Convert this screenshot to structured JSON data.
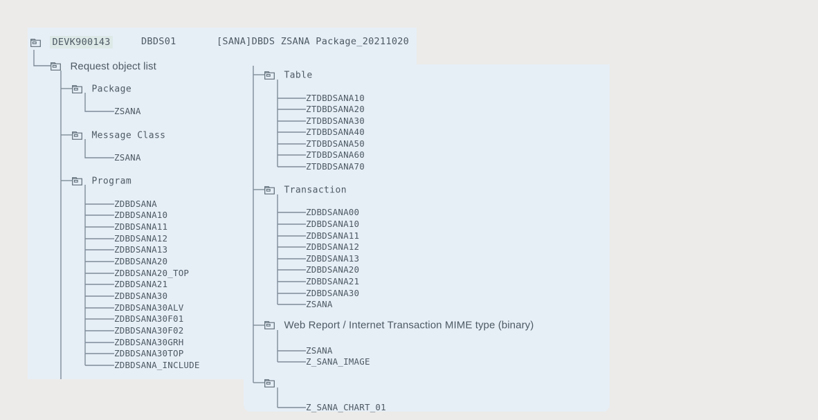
{
  "header": {
    "folder_icon": "folder-icon",
    "request_id": "DEVK900143",
    "system": "DBDS01",
    "description": "[SANA]DBDS ZSANA Package_20211020"
  },
  "colors": {
    "page_background": "#ecebe9",
    "panel_background": "#e6eef6",
    "tree_line": "#7e8c99",
    "text": "#4d5a63",
    "highlight": "#dde9e7"
  },
  "tree": {
    "root": {
      "label": "Request object list",
      "icon": "folder-icon"
    },
    "left_column": [
      {
        "label": "Package",
        "icon": "folder-icon",
        "children": [
          "ZSANA"
        ]
      },
      {
        "label": "Message Class",
        "icon": "folder-icon",
        "children": [
          "ZSANA"
        ]
      },
      {
        "label": "Program",
        "icon": "folder-icon",
        "children": [
          "ZDBDSANA",
          "ZDBDSANA10",
          "ZDBDSANA11",
          "ZDBDSANA12",
          "ZDBDSANA13",
          "ZDBDSANA20",
          "ZDBDSANA20_TOP",
          "ZDBDSANA21",
          "ZDBDSANA30",
          "ZDBDSANA30ALV",
          "ZDBDSANA30F01",
          "ZDBDSANA30F02",
          "ZDBDSANA30GRH",
          "ZDBDSANA30TOP",
          "ZDBDSANA_INCLUDE"
        ]
      }
    ],
    "right_column": [
      {
        "label": "Table",
        "icon": "folder-icon",
        "children": [
          "ZTDBDSANA10",
          "ZTDBDSANA20",
          "ZTDBDSANA30",
          "ZTDBDSANA40",
          "ZTDBDSANA50",
          "ZTDBDSANA60",
          "ZTDBDSANA70"
        ]
      },
      {
        "label": "Transaction",
        "icon": "folder-icon",
        "children": [
          "ZDBDSANA00",
          "ZDBDSANA10",
          "ZDBDSANA11",
          "ZDBDSANA12",
          "ZDBDSANA13",
          "ZDBDSANA20",
          "ZDBDSANA21",
          "ZDBDSANA30",
          "ZSANA"
        ]
      },
      {
        "label": "Web Report / Internet Transaction MIME type (binary)",
        "icon": "folder-icon",
        "children": [
          "ZSANA",
          "Z_SANA_IMAGE"
        ]
      },
      {
        "label": "",
        "icon": "folder-icon",
        "children": [
          "Z_SANA_CHART_01"
        ]
      }
    ]
  }
}
